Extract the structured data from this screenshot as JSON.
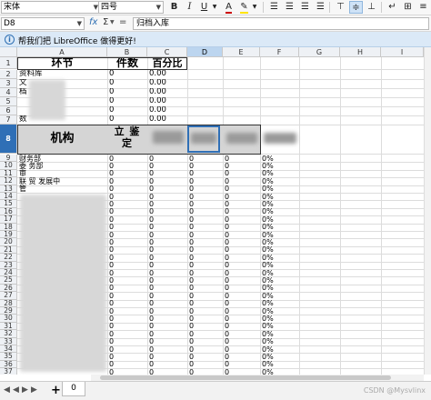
{
  "toolbar": {
    "font_name": "宋体",
    "font_size": "四号",
    "bold": "B",
    "italic": "I",
    "underline": "U"
  },
  "formula_bar": {
    "cell_ref": "D8",
    "fx": "fx",
    "sigma": "Σ",
    "equals": "=",
    "content": "归档入库"
  },
  "infobar": {
    "message": "帮我们把 LibreOffice 做得更好!"
  },
  "columns": [
    "A",
    "B",
    "C",
    "D",
    "E",
    "F",
    "G",
    "H",
    "I"
  ],
  "header_row": {
    "col_a": "环节",
    "col_b": "件数",
    "col_c": "百分比"
  },
  "top_rows": [
    {
      "num": "2",
      "a": "资料库",
      "b": "0",
      "c": "0.00"
    },
    {
      "num": "3",
      "a": "文",
      "b": "0",
      "c": "0.00"
    },
    {
      "num": "4",
      "a": "档",
      "b": "0",
      "c": "0.00"
    },
    {
      "num": "5",
      "a": "",
      "b": "0",
      "c": "0.00"
    },
    {
      "num": "6",
      "a": "",
      "b": "0",
      "c": "0.00"
    },
    {
      "num": "7",
      "a": "数",
      "b": "0",
      "c": "0.00"
    }
  ],
  "row8": {
    "num": "8",
    "a": "机构",
    "b": "立 鉴 定"
  },
  "bottom_rows": [
    {
      "num": "9",
      "a": "财务部"
    },
    {
      "num": "10",
      "a": "委 务部"
    },
    {
      "num": "11",
      "a": "审"
    },
    {
      "num": "12",
      "a": "联     贸 发展中"
    },
    {
      "num": "13",
      "a": "       管"
    },
    {
      "num": "14",
      "a": ""
    },
    {
      "num": "15",
      "a": ""
    },
    {
      "num": "16",
      "a": ""
    },
    {
      "num": "17",
      "a": ""
    },
    {
      "num": "18",
      "a": ""
    },
    {
      "num": "19",
      "a": ""
    },
    {
      "num": "20",
      "a": ""
    },
    {
      "num": "21",
      "a": ""
    },
    {
      "num": "22",
      "a": ""
    },
    {
      "num": "23",
      "a": ""
    },
    {
      "num": "24",
      "a": ""
    },
    {
      "num": "25",
      "a": ""
    },
    {
      "num": "26",
      "a": ""
    },
    {
      "num": "27",
      "a": ""
    },
    {
      "num": "28",
      "a": ""
    },
    {
      "num": "29",
      "a": ""
    },
    {
      "num": "30",
      "a": ""
    },
    {
      "num": "31",
      "a": ""
    },
    {
      "num": "32",
      "a": ""
    },
    {
      "num": "33",
      "a": ""
    },
    {
      "num": "34",
      "a": ""
    },
    {
      "num": "35",
      "a": ""
    },
    {
      "num": "36",
      "a": ""
    },
    {
      "num": "37",
      "a": ""
    }
  ],
  "bottom_values": {
    "zero": "0",
    "pct": "0%"
  },
  "sheet_tabs": {
    "add": "+",
    "tab": "0"
  },
  "watermark": "CSDN @Mysvlinx",
  "colors": {
    "selection": "#2f6fb6",
    "info_bg": "#dbe9f7"
  }
}
